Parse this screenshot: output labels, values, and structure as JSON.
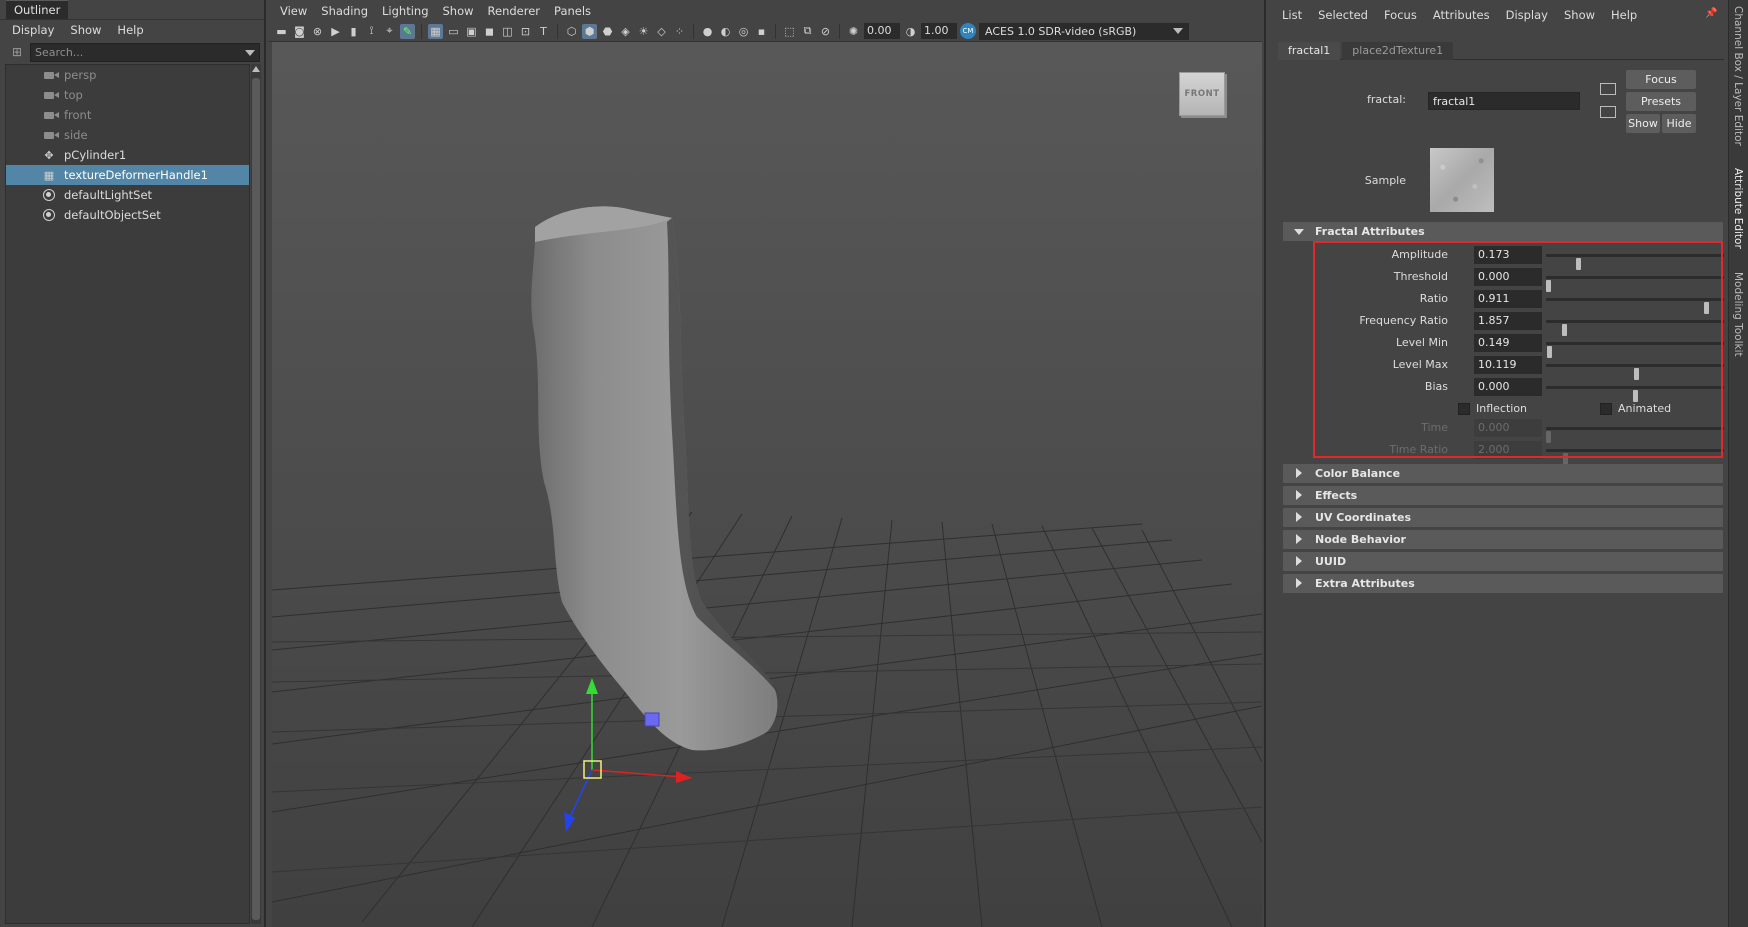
{
  "outliner": {
    "title": "Outliner",
    "menu": [
      "Display",
      "Show",
      "Help"
    ],
    "search_placeholder": "Search...",
    "items": [
      {
        "label": "persp",
        "icon": "camera-icon",
        "dim": true
      },
      {
        "label": "top",
        "icon": "camera-icon",
        "dim": true
      },
      {
        "label": "front",
        "icon": "camera-icon",
        "dim": true
      },
      {
        "label": "side",
        "icon": "camera-icon",
        "dim": true
      },
      {
        "label": "pCylinder1",
        "icon": "mesh-transform-icon",
        "dim": false
      },
      {
        "label": "textureDeformerHandle1",
        "icon": "deformer-handle-icon",
        "dim": false,
        "selected": true
      },
      {
        "label": "defaultLightSet",
        "icon": "set-icon",
        "dim": false
      },
      {
        "label": "defaultObjectSet",
        "icon": "set-icon",
        "dim": false
      }
    ]
  },
  "viewport": {
    "menu": [
      "View",
      "Shading",
      "Lighting",
      "Show",
      "Renderer",
      "Panels"
    ],
    "exposure": "0.00",
    "gamma": "1.00",
    "color_space": "ACES 1.0 SDR-video (sRGB)",
    "viewcube_label": "FRONT"
  },
  "attribute_editor": {
    "menu": [
      "List",
      "Selected",
      "Focus",
      "Attributes",
      "Display",
      "Show",
      "Help"
    ],
    "tabs": [
      "fractal1",
      "place2dTexture1"
    ],
    "node_type_label": "fractal:",
    "node_name": "fractal1",
    "buttons": {
      "focus": "Focus",
      "presets": "Presets",
      "show": "Show",
      "hide": "Hide"
    },
    "sample_label": "Sample",
    "fractal_section": "Fractal Attributes",
    "attributes": [
      {
        "label": "Amplitude",
        "value": "0.173",
        "slider": 0.173,
        "disabled": false
      },
      {
        "label": "Threshold",
        "value": "0.000",
        "slider": 0.0,
        "disabled": false
      },
      {
        "label": "Ratio",
        "value": "0.911",
        "slider": 0.911,
        "disabled": false
      },
      {
        "label": "Frequency Ratio",
        "value": "1.857",
        "slider": 0.093,
        "disabled": false
      },
      {
        "label": "Level Min",
        "value": "0.149",
        "slider": 0.0075,
        "disabled": false
      },
      {
        "label": "Level Max",
        "value": "10.119",
        "slider": 0.506,
        "disabled": false
      },
      {
        "label": "Bias",
        "value": "0.000",
        "slider": 0.5,
        "disabled": false
      },
      {
        "label": "Time",
        "value": "0.000",
        "slider": 0.0,
        "disabled": true
      },
      {
        "label": "Time Ratio",
        "value": "2.000",
        "slider": 0.1,
        "disabled": true
      }
    ],
    "checkboxes": {
      "inflection": "Inflection",
      "animated": "Animated"
    },
    "collapsed_sections": [
      "Color Balance",
      "Effects",
      "UV Coordinates",
      "Node Behavior",
      "UUID",
      "Extra Attributes"
    ],
    "highlight_color": "#e0282e"
  },
  "side_tabs": [
    "Channel Box / Layer Editor",
    "Attribute Editor",
    "Modeling Toolkit"
  ]
}
